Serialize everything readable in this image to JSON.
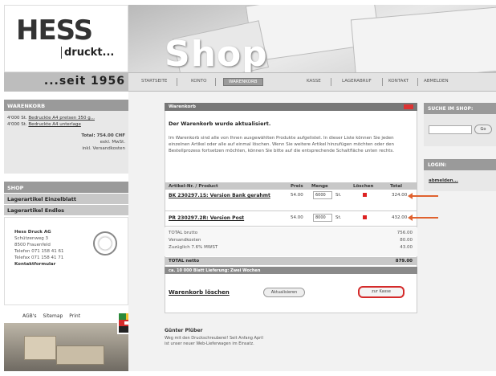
{
  "brand": {
    "logo_main": "HESS",
    "logo_sub": "druckt...",
    "since": "...seit 1956"
  },
  "header": {
    "title": "Shop"
  },
  "nav": {
    "items": [
      "STARTSEITE",
      "KONTO",
      "WARENKORB",
      "KASSE",
      "LAGERABRUF",
      "KONTAKT",
      "ABMELDEN"
    ],
    "active": "WARENKORB"
  },
  "sidebar": {
    "cart_header": "WARENKORB",
    "cart_items": [
      {
        "prefix": "4'000 St.",
        "name": "Bedruckte A4 pretsen 350 g..."
      },
      {
        "prefix": "4'000 St.",
        "name": "Bedruckte A4 unterlage"
      }
    ],
    "cart_total": "Total: 754.00 CHF",
    "cart_note1": "exkl. MwSt.",
    "cart_note2": "inkl. Versandkosten",
    "shop_header": "SHOP",
    "menu": [
      "Lagerartikel Einzelblatt",
      "Lagerartikel Endlos"
    ],
    "address": {
      "company": "Hess Druck AG",
      "street": "Schützenweg 3",
      "city": "8500 Frauenfeld",
      "tel": "Telefon 071 158 41 61",
      "fax": "Telefax 071 158 41 71",
      "contact": "Kontaktformular"
    },
    "footer_links": [
      "AGB's",
      "Sitemap",
      "Print"
    ]
  },
  "cart": {
    "title": "Warenkorb",
    "updated": "Der Warenkorb wurde aktualisiert.",
    "info": "Im Warenkorb sind alle von Ihnen ausgewählten Produkte aufgelistet. In dieser Liste können Sie jeden einzelnen Artikel oder alle auf einmal löschen. Wenn Sie weitere Artikel hinzufügen möchten oder den Bestellprozess fortsetzen möchten, können Sie bitte auf die entsprechende Schaltfläche unten rechts.",
    "columns": [
      "Artikel-Nr. / Product",
      "Preis",
      "Menge",
      "Löschen",
      "Total"
    ],
    "rows": [
      {
        "product": "BK 230297.1S: Version Bank gerahmt",
        "price": "54.00",
        "qty": "6000",
        "unit": "St.",
        "total": "324.00"
      },
      {
        "product": "PR 230297.2R: Version Post",
        "price": "54.00",
        "qty": "8000",
        "unit": "St.",
        "total": "432.00"
      }
    ],
    "totals": [
      {
        "label": "TOTAL brutto",
        "value": "756.00"
      },
      {
        "label": "Versandkosten",
        "value": "80.00"
      },
      {
        "label": "Zuzüglich 7.6% MWST",
        "value": "43.00"
      }
    ],
    "net_label": "TOTAL netto",
    "net_value": "879.00",
    "delivery": "ca. 10 000 Blatt Lieferung: Zwei Wochen",
    "clear_link": "Warenkorb löschen",
    "update_btn": "Aktualisieren",
    "checkout_btn": "zur Kasse"
  },
  "right": {
    "search_header": "SUCHE IM SHOP:",
    "search_btn": "Go",
    "login_header": "LOGIN:",
    "login_link": "abmelden..."
  },
  "bottom": {
    "title": "Günter Plüber",
    "desc1": "Weg mit den Druckschreuberei! Seit Anfang April",
    "desc2": "ist unser neuer Web-Lieferwagen im Einsatz."
  },
  "colors": {
    "accent_red": "#d42a2a",
    "arrow_orange": "#e0622f",
    "header_gray": "#9a9a9a"
  }
}
